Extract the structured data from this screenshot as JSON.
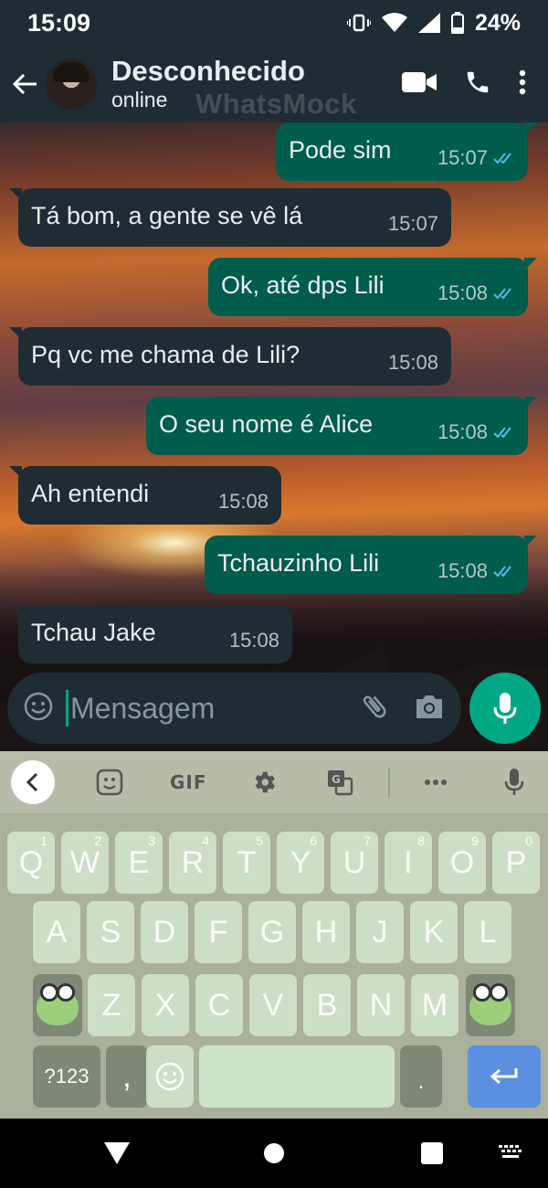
{
  "status_bar": {
    "time": "15:09",
    "battery": "24%"
  },
  "header": {
    "contact_name": "Desconhecido",
    "contact_status": "online",
    "watermark": "WhatsMock"
  },
  "messages": [
    {
      "direction": "out",
      "text": "Pode sim",
      "time": "15:07",
      "ticks": "read"
    },
    {
      "direction": "in",
      "text": "Tá bom, a gente se vê lá",
      "time": "15:07"
    },
    {
      "direction": "out",
      "text": "Ok, até dps Lili",
      "time": "15:08",
      "ticks": "read"
    },
    {
      "direction": "in",
      "text": "Pq vc me chama de Lili?",
      "time": "15:08"
    },
    {
      "direction": "out",
      "text": "O seu nome é Alice",
      "time": "15:08",
      "ticks": "read"
    },
    {
      "direction": "in",
      "text": "Ah entendi",
      "time": "15:08"
    },
    {
      "direction": "out",
      "text": "Tchauzinho Lili",
      "time": "15:08",
      "ticks": "read"
    },
    {
      "direction": "in",
      "text": "Tchau Jake",
      "time": "15:08"
    }
  ],
  "input": {
    "placeholder": "Mensagem"
  },
  "keyboard": {
    "toolbar": {
      "gif_label": "GIF"
    },
    "row1": [
      {
        "key": "Q",
        "hint": "1"
      },
      {
        "key": "W",
        "hint": "2"
      },
      {
        "key": "E",
        "hint": "3"
      },
      {
        "key": "R",
        "hint": "4"
      },
      {
        "key": "T",
        "hint": "5"
      },
      {
        "key": "Y",
        "hint": "6"
      },
      {
        "key": "U",
        "hint": "7"
      },
      {
        "key": "I",
        "hint": "8"
      },
      {
        "key": "O",
        "hint": "9"
      },
      {
        "key": "P",
        "hint": "0"
      }
    ],
    "row2": [
      "A",
      "S",
      "D",
      "F",
      "G",
      "H",
      "J",
      "K",
      "L"
    ],
    "row3": [
      "Z",
      "X",
      "C",
      "V",
      "B",
      "N",
      "M"
    ],
    "bottom": {
      "symbols_label": "?123",
      "comma": ",",
      "period": "."
    }
  },
  "colors": {
    "header": "#1f2c34",
    "outgoing_bubble": "#005c4b",
    "incoming_bubble": "#202c33",
    "accent": "#00a884",
    "read_ticks": "#53bdeb"
  }
}
